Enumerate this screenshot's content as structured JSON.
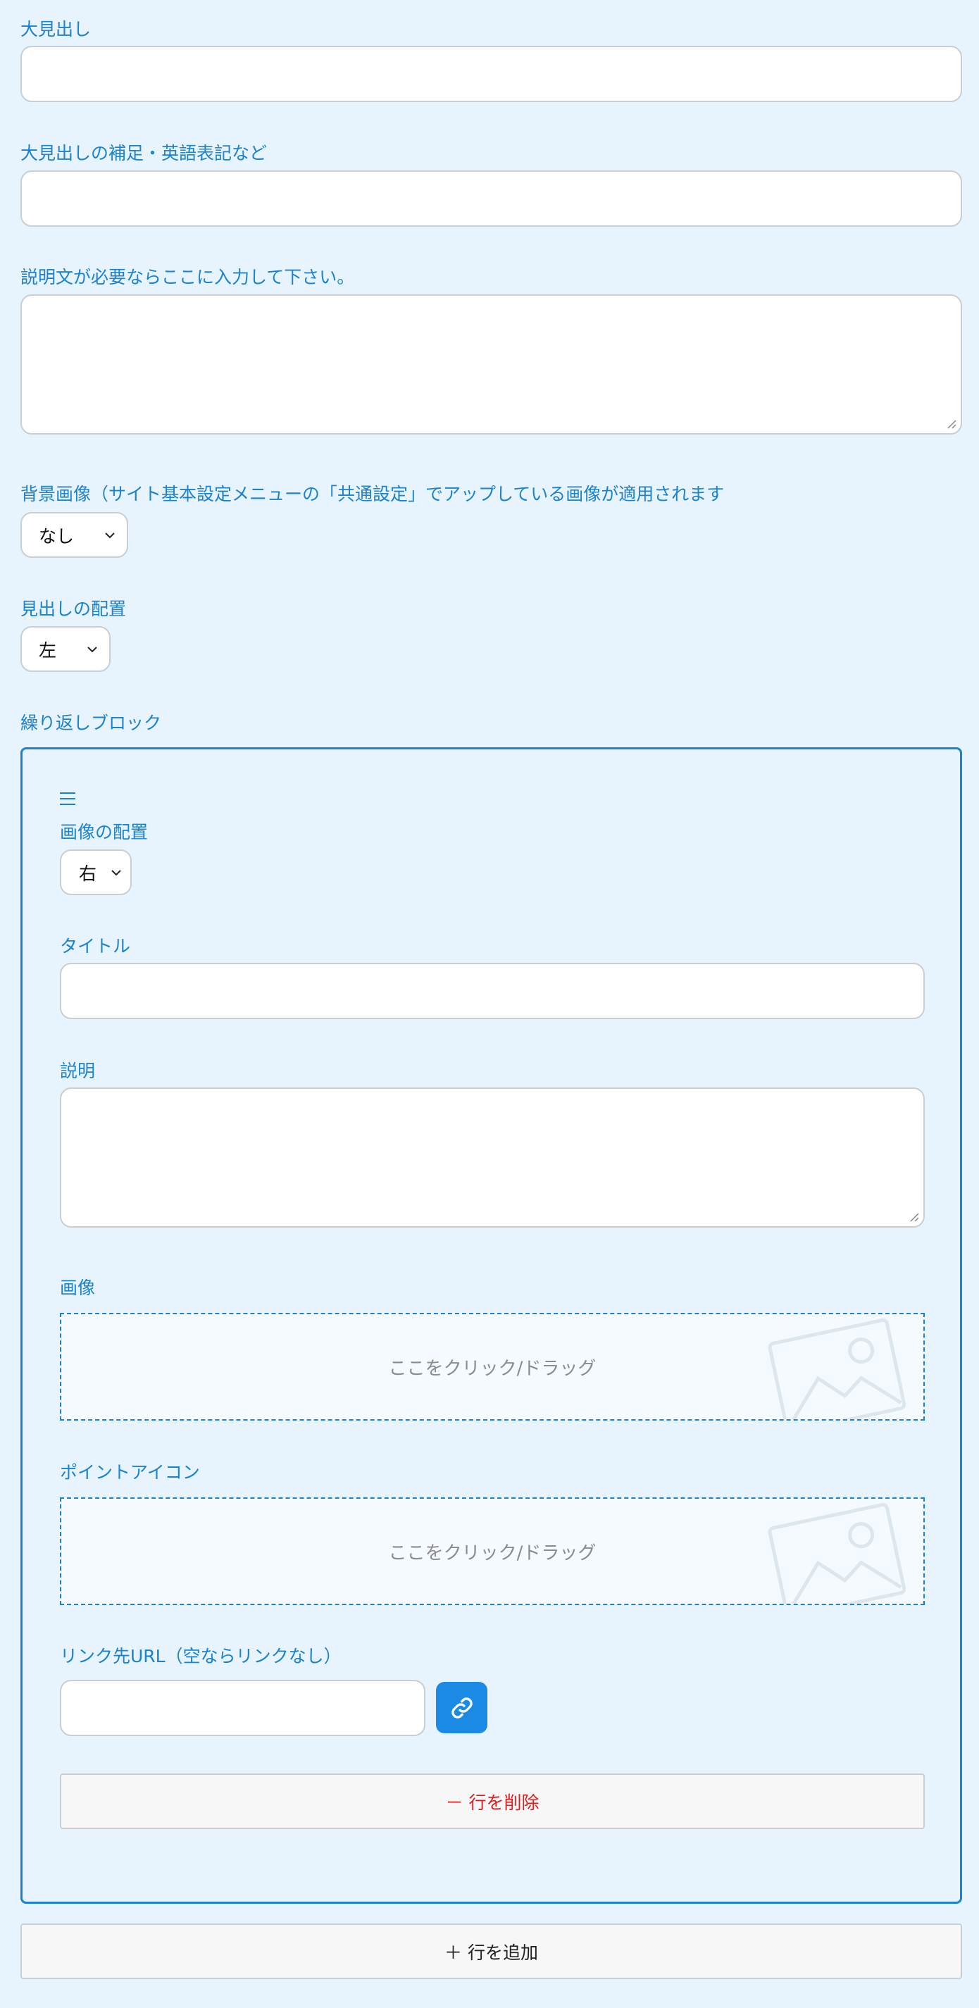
{
  "fields": {
    "heading_label": "大見出し",
    "heading_value": "",
    "subheading_label": "大見出しの補足・英語表記など",
    "subheading_value": "",
    "description_label": "説明文が必要ならここに入力して下さい。",
    "description_value": "",
    "bg_image_label": "背景画像（サイト基本設定メニューの「共通設定」でアップしている画像が適用されます",
    "bg_image_value": "なし",
    "heading_align_label": "見出しの配置",
    "heading_align_value": "左",
    "repeat_block_label": "繰り返しブロック"
  },
  "block": {
    "handle_icon": "drag-handle-icon",
    "image_position_label": "画像の配置",
    "image_position_value": "右",
    "title_label": "タイトル",
    "title_value": "",
    "desc_label": "説明",
    "desc_value": "",
    "image_label": "画像",
    "image_drop_text": "ここをクリック/ドラッグ",
    "point_icon_label": "ポイントアイコン",
    "point_icon_drop_text": "ここをクリック/ドラッグ",
    "link_label": "リンク先URL（空ならリンクなし）",
    "link_value": "",
    "delete_row_label": "－ 行を削除"
  },
  "add_row_label": "＋ 行を追加",
  "colors": {
    "accent": "#1b82d1",
    "background": "#e8f4fd",
    "delete": "#e21c1c",
    "link_button": "#1b8ae4"
  }
}
